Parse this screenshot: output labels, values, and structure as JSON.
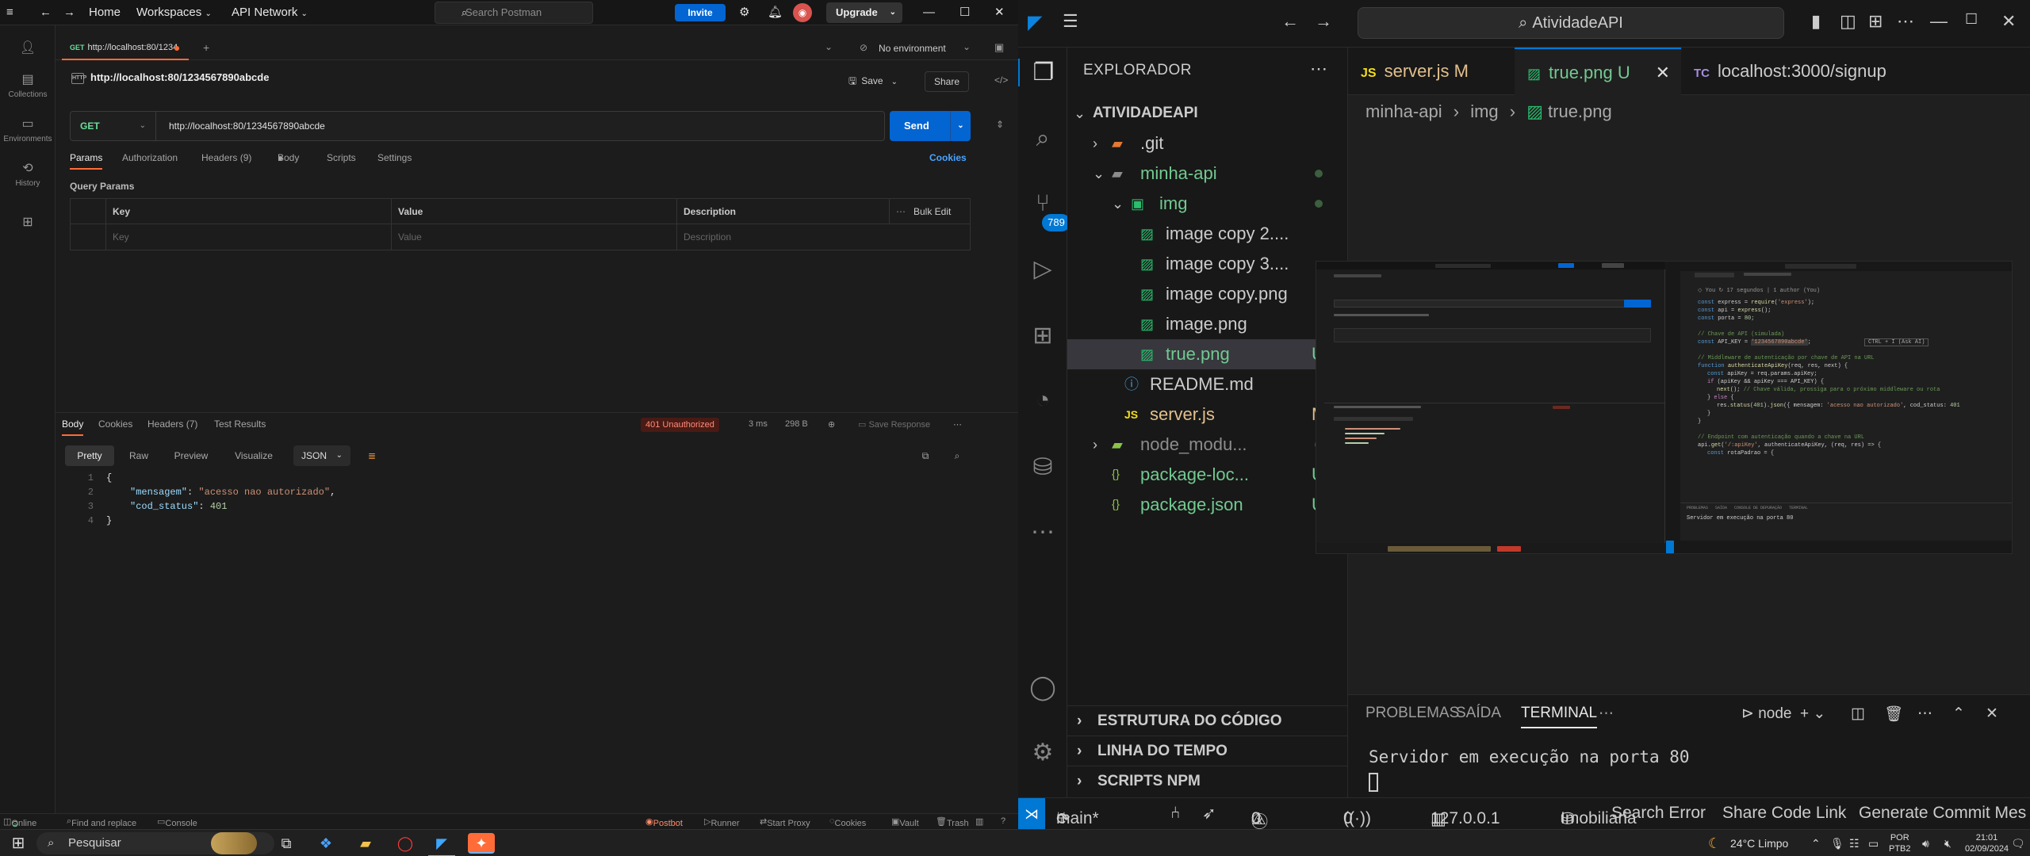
{
  "postman": {
    "nav": {
      "home": "Home",
      "workspaces": "Workspaces",
      "api_network": "API Network",
      "search_placeholder": "Search Postman",
      "invite": "Invite",
      "upgrade": "Upgrade"
    },
    "sidebar": [
      {
        "label": "Collections",
        "icon": "collections-icon"
      },
      {
        "label": "Environments",
        "icon": "environments-icon"
      },
      {
        "label": "History",
        "icon": "history-icon"
      }
    ],
    "tab": {
      "method": "GET",
      "label": "http://localhost:80/1234"
    },
    "environment": "No environment",
    "request": {
      "title": "http://localhost:80/1234567890abcde",
      "save": "Save",
      "share": "Share",
      "method": "GET",
      "url": "http://localhost:80/1234567890abcde",
      "send": "Send",
      "tabs": [
        "Params",
        "Authorization",
        "Headers (9)",
        "Body",
        "Scripts",
        "Settings"
      ],
      "cookies": "Cookies",
      "query_params_label": "Query Params",
      "columns": [
        "Key",
        "Value",
        "Description"
      ],
      "bulk_edit": "Bulk Edit",
      "placeholders": [
        "Key",
        "Value",
        "Description"
      ]
    },
    "response": {
      "tabs": [
        "Body",
        "Cookies",
        "Headers (7)",
        "Test Results"
      ],
      "status": "401 Unauthorized",
      "time": "3 ms",
      "size": "298 B",
      "save_response": "Save Response",
      "formats": [
        "Pretty",
        "Raw",
        "Preview",
        "Visualize"
      ],
      "lang": "JSON",
      "lines": [
        "1",
        "2",
        "3",
        "4"
      ],
      "body": {
        "open": "{",
        "key1": "\"mensagem\"",
        "val1": "\"acesso nao autorizado\"",
        "key2": "\"cod_status\"",
        "val2": "401",
        "close": "}"
      }
    },
    "footer": [
      "Online",
      "Find and replace",
      "Console",
      "Postbot",
      "Runner",
      "Start Proxy",
      "Cookies",
      "Vault",
      "Trash"
    ]
  },
  "vscode": {
    "command_center": "AtividadeAPI",
    "explorer_title": "EXPLORADOR",
    "scm_badge": "789",
    "root": "ATIVIDADEAPI",
    "tree": [
      {
        "name": ".git",
        "status": ""
      },
      {
        "name": "minha-api",
        "status": ""
      },
      {
        "name": "img",
        "status": ""
      },
      {
        "name": "image copy 2....",
        "status": ""
      },
      {
        "name": "image copy 3....",
        "status": ""
      },
      {
        "name": "image copy.png",
        "status": ""
      },
      {
        "name": "image.png",
        "status": ""
      },
      {
        "name": "true.png",
        "status": "U"
      },
      {
        "name": "README.md",
        "status": ""
      },
      {
        "name": "server.js",
        "status": "M"
      },
      {
        "name": "node_modu...",
        "status": ""
      },
      {
        "name": "package-loc...",
        "status": "U"
      },
      {
        "name": "package.json",
        "status": "U"
      }
    ],
    "sections": [
      "ESTRUTURA DO CÓDIGO",
      "LINHA DO TEMPO",
      "SCRIPTS NPM"
    ],
    "tabs": [
      {
        "label": "server.js",
        "status": "M"
      },
      {
        "label": "true.png",
        "status": "U"
      },
      {
        "label": "localhost:3000/signup",
        "status": ""
      }
    ],
    "breadcrumb": [
      "minha-api",
      "img",
      "true.png"
    ],
    "panel_tabs": [
      "PROBLEMAS",
      "SAÍDA",
      "TERMINAL"
    ],
    "terminal_shell": "node",
    "terminal_output": "Servidor em execução na porta 80",
    "status": {
      "branch": "main*",
      "errors": "0",
      "warnings": "0",
      "ports": "0",
      "host": "127.0.0.1",
      "db": "Imobiliaria",
      "search_error": "Search Error",
      "share_link": "Share Code Link",
      "commit": "Generate Commit Mes"
    },
    "thumbnail_text": {
      "code_lines": [
        "const express = require('express');",
        "const api = express();",
        "const porta = 80;",
        "// Chave de API (simulada)",
        "const API_KEY = '1234567890abcde';",
        "// Middleware de autenticação por chave de API na URL",
        "function authenticateApiKey(req, res, next) {",
        "  const apiKey = req.params.apiKey;",
        "  if (apiKey && apiKey === API_KEY) {",
        "    next(); // Chave válida, prossiga para o próximo middleware ou rota",
        "  } else {",
        "    res.status(401).json({ mensagem: 'acesso nao autorizado', cod_status: 401 });",
        "  }",
        "}",
        "// Endpoint com autenticação quando a chave na URL",
        "api.get('/:apiKey', authenticateApiKey, (req, res) => {",
        "  const rotaPadrao = {"
      ],
      "terminal": "Servidor em execução na porta 80",
      "hint": "CTRL + I (Ask AI)"
    }
  },
  "taskbar": {
    "search": "Pesquisar",
    "weather": "24°C  Limpo",
    "lang1": "POR",
    "lang2": "PTB2",
    "time": "21:01",
    "date": "02/09/2024"
  },
  "colors": {
    "postman_orange": "#ff6c37",
    "postman_blue": "#0265d2",
    "vscode_blue": "#0078d4",
    "error_red": "#ff8c7a"
  }
}
